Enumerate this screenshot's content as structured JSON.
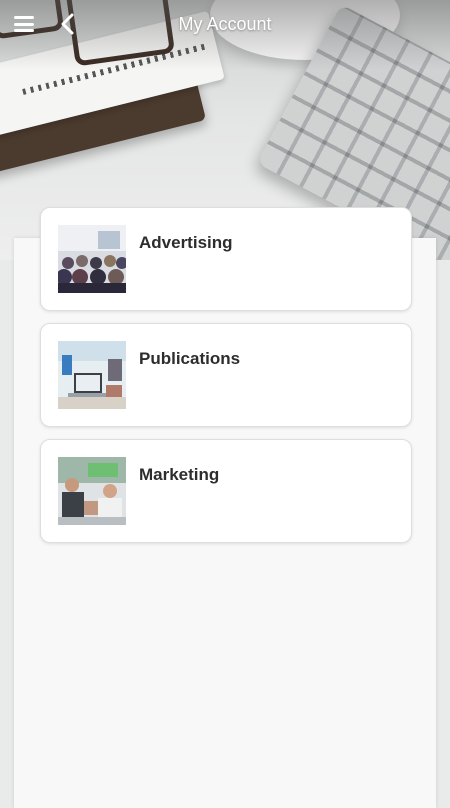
{
  "header": {
    "title": "My Account",
    "menu_icon": "hamburger-menu-icon",
    "back_icon": "chevron-left-icon"
  },
  "colors": {
    "header_text": "#ffffff",
    "card_label": "#2d2d2d",
    "panel_background": "#f8f8f8"
  },
  "items": [
    {
      "label": "Advertising",
      "thumbnail": "audience-seminar-photo"
    },
    {
      "label": "Publications",
      "thumbnail": "laptop-office-photo"
    },
    {
      "label": "Marketing",
      "thumbnail": "business-people-clapping-photo"
    }
  ]
}
